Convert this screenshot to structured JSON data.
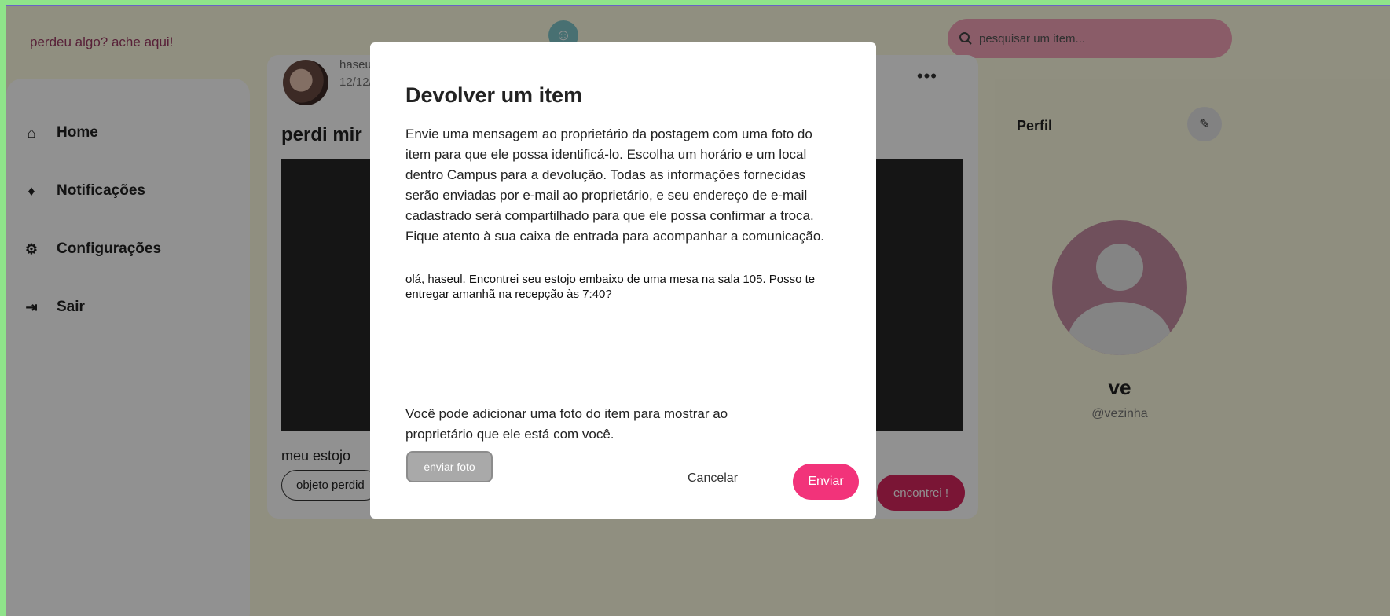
{
  "header": {
    "site_title": "perdeu algo? ache aqui!",
    "search_placeholder": "pesquisar um item...",
    "search_icon": "search-icon",
    "accessibility_icon": "accessibility-icon"
  },
  "sidebar": {
    "items": [
      {
        "label": "Home",
        "icon": "home-icon"
      },
      {
        "label": "Notificações",
        "icon": "bell-icon"
      },
      {
        "label": "Configurações",
        "icon": "gear-icon"
      },
      {
        "label": "Sair",
        "icon": "logout-icon"
      }
    ]
  },
  "post": {
    "user": "haseu",
    "date": "12/12/1",
    "title": "perdi mir",
    "description": "meu estojo",
    "tag": "objeto perdid",
    "found_button": "encontrei !",
    "more_icon": "more-icon"
  },
  "profile": {
    "title": "Perfil",
    "name": "ve",
    "handle": "@vezinha",
    "edit_icon": "edit-icon"
  },
  "modal": {
    "title": "Devolver um item",
    "description": "Envie uma mensagem ao proprietário da postagem com uma foto do item para que ele possa identificá-lo. Escolha um horário e um local dentro Campus para a devolução. Todas as informações fornecidas serão enviadas por e-mail ao proprietário, e seu endereço de e-mail cadastrado será compartilhado para que ele possa confirmar a troca. Fique atento à sua caixa de entrada para acompanhar a comunicação.",
    "message": "olá, haseul. Encontrei seu estojo embaixo de uma mesa na sala 105. Posso te entregar amanhã na recepção às 7:40?",
    "photo_hint": "Você pode adicionar uma foto do item para mostrar ao proprietário que ele está com você.",
    "photo_button": "enviar foto",
    "cancel_button": "Cancelar",
    "send_button": "Enviar"
  },
  "colors": {
    "accent": "#f2337a",
    "found": "#d6255e",
    "search_bg": "#f2a3b7",
    "page_bg": "#fdfbe2",
    "outer_bg": "#8fe38a"
  }
}
